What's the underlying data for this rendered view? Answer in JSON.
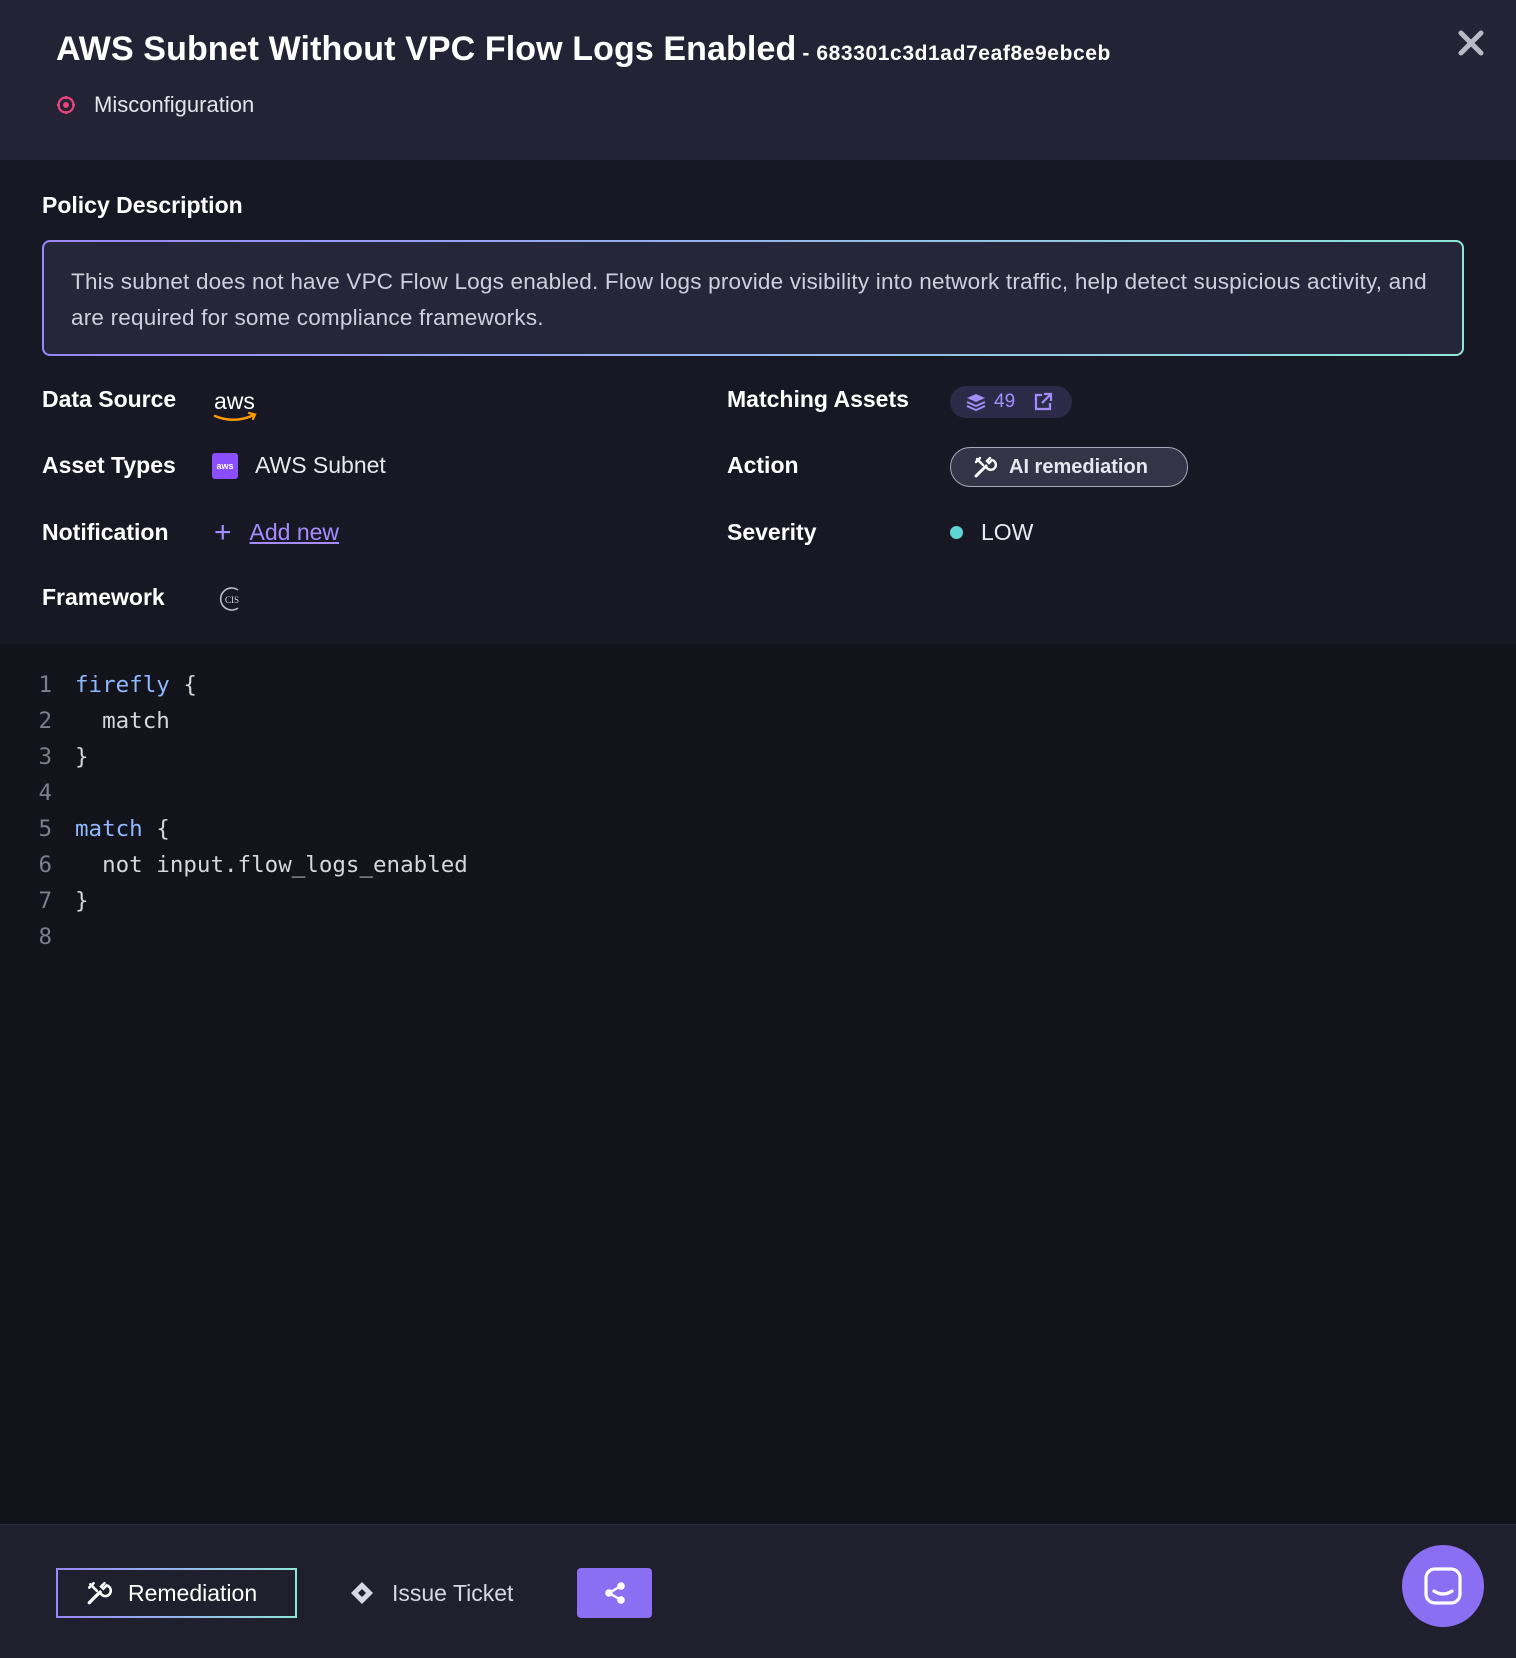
{
  "header": {
    "title": "AWS Subnet Without VPC Flow Logs Enabled",
    "id_suffix": "- 683301c3d1ad7eaf8e9ebceb",
    "category": "Misconfiguration",
    "category_icon": "misconfiguration-icon",
    "close_icon": "close-icon"
  },
  "policy": {
    "section_title": "Policy Description",
    "description": "This subnet does not have VPC Flow Logs enabled. Flow logs provide visibility into network traffic, help detect suspicious activity, and are required for some compliance frameworks."
  },
  "details": {
    "data_source": {
      "label": "Data Source",
      "logo": "aws",
      "logo_icon": "aws-logo"
    },
    "asset_types": {
      "label": "Asset Types",
      "value": "AWS Subnet",
      "icon": "aws-subnet-icon",
      "icon_text": "aws"
    },
    "notification": {
      "label": "Notification",
      "plus": "+",
      "link": "Add new"
    },
    "framework": {
      "label": "Framework",
      "icon": "cis-icon",
      "icon_text": "CIS"
    },
    "matching_assets": {
      "label": "Matching Assets",
      "count": "49",
      "icon": "layers-icon",
      "link_icon": "external-link-icon"
    },
    "action": {
      "label": "Action",
      "value": "AI remediation",
      "icon": "wrench-icon"
    },
    "severity": {
      "label": "Severity",
      "value": "LOW",
      "color": "#5fd6d6"
    }
  },
  "code": {
    "lines": [
      {
        "n": "1",
        "kw": "firefly",
        "rest": " {"
      },
      {
        "n": "2",
        "kw": "",
        "rest": "  match"
      },
      {
        "n": "3",
        "kw": "",
        "rest": "}"
      },
      {
        "n": "4",
        "kw": "",
        "rest": ""
      },
      {
        "n": "5",
        "kw": "match",
        "rest": " {"
      },
      {
        "n": "6",
        "kw": "",
        "rest": "  not input.flow_logs_enabled"
      },
      {
        "n": "7",
        "kw": "",
        "rest": "}"
      },
      {
        "n": "8",
        "kw": "",
        "rest": ""
      }
    ]
  },
  "footer": {
    "remediation": "Remediation",
    "issue_ticket": "Issue Ticket",
    "share_icon": "share-icon",
    "chat_icon": "chat-icon"
  },
  "colors": {
    "accent": "#8b6ff2",
    "link": "#a48cff",
    "gradient_start": "#9b86ff",
    "gradient_end": "#8de6d8",
    "misconfig_red": "#e8437a"
  }
}
